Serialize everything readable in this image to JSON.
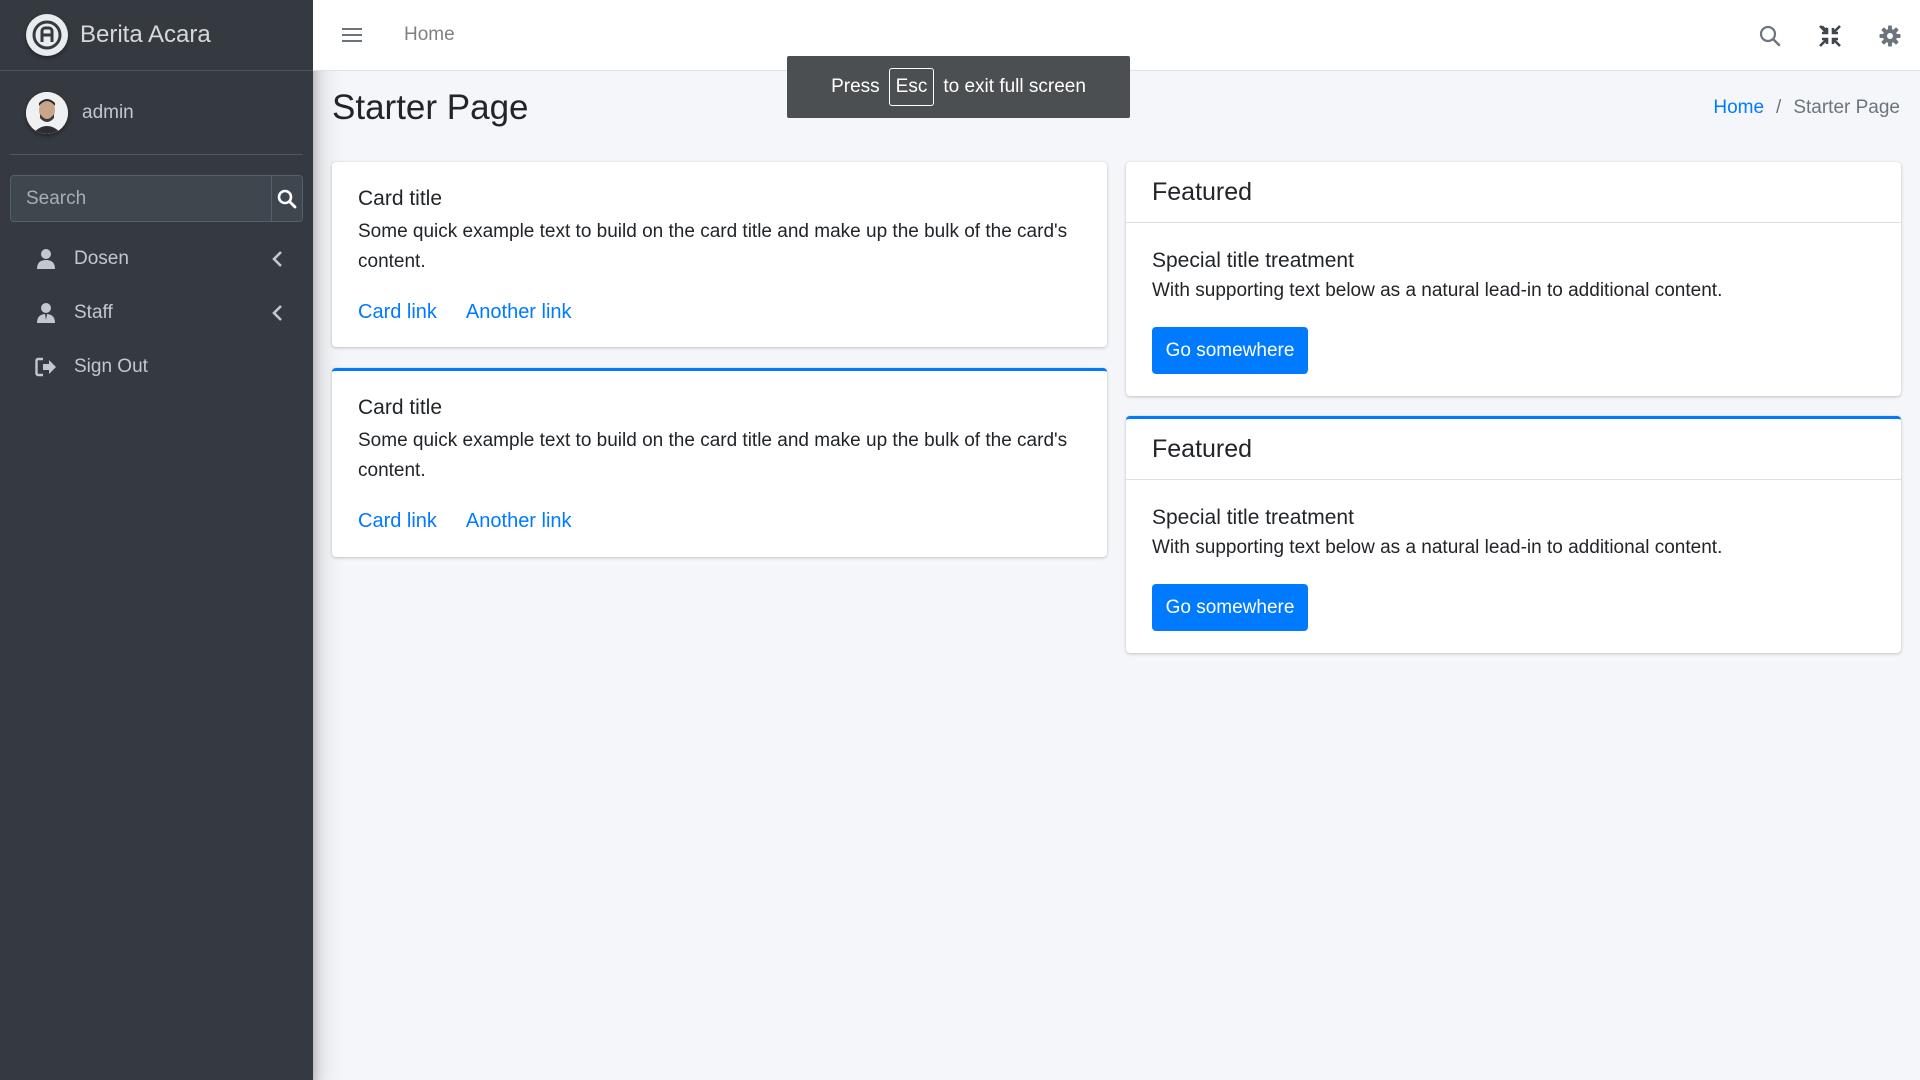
{
  "sidebar": {
    "brand": "Berita Acara",
    "user": "admin",
    "search_placeholder": "Search",
    "items": [
      {
        "label": "Dosen",
        "icon": "user-icon"
      },
      {
        "label": "Staff",
        "icon": "user-tie-icon"
      },
      {
        "label": "Sign Out",
        "icon": "sign-out-icon"
      }
    ]
  },
  "topbar": {
    "home_link": "Home",
    "icons": [
      "search-icon",
      "compress-icon",
      "gear-icon"
    ]
  },
  "fullscreen_toast": {
    "prefix": "Press",
    "key": "Esc",
    "suffix": "to exit full screen"
  },
  "content": {
    "page_title": "Starter Page",
    "breadcrumb": {
      "link": "Home",
      "separator": "/",
      "active": "Starter Page"
    },
    "left_cards": [
      {
        "title": "Card title",
        "text": "Some quick example text to build on the card title and make up the bulk of the card's content.",
        "link1": "Card link",
        "link2": "Another link"
      },
      {
        "title": "Card title",
        "text": "Some quick example text to build on the card title and make up the bulk of the card's content.",
        "link1": "Card link",
        "link2": "Another link"
      }
    ],
    "right_cards": [
      {
        "header": "Featured",
        "title": "Special title treatment",
        "text": "With supporting text below as a natural lead-in to additional content.",
        "button": "Go somewhere"
      },
      {
        "header": "Featured",
        "title": "Special title treatment",
        "text": "With supporting text below as a natural lead-in to additional content.",
        "button": "Go somewhere"
      }
    ]
  },
  "colors": {
    "sidebar_bg": "#343a40",
    "primary": "#007bff",
    "page_bg": "#f4f6f9"
  }
}
